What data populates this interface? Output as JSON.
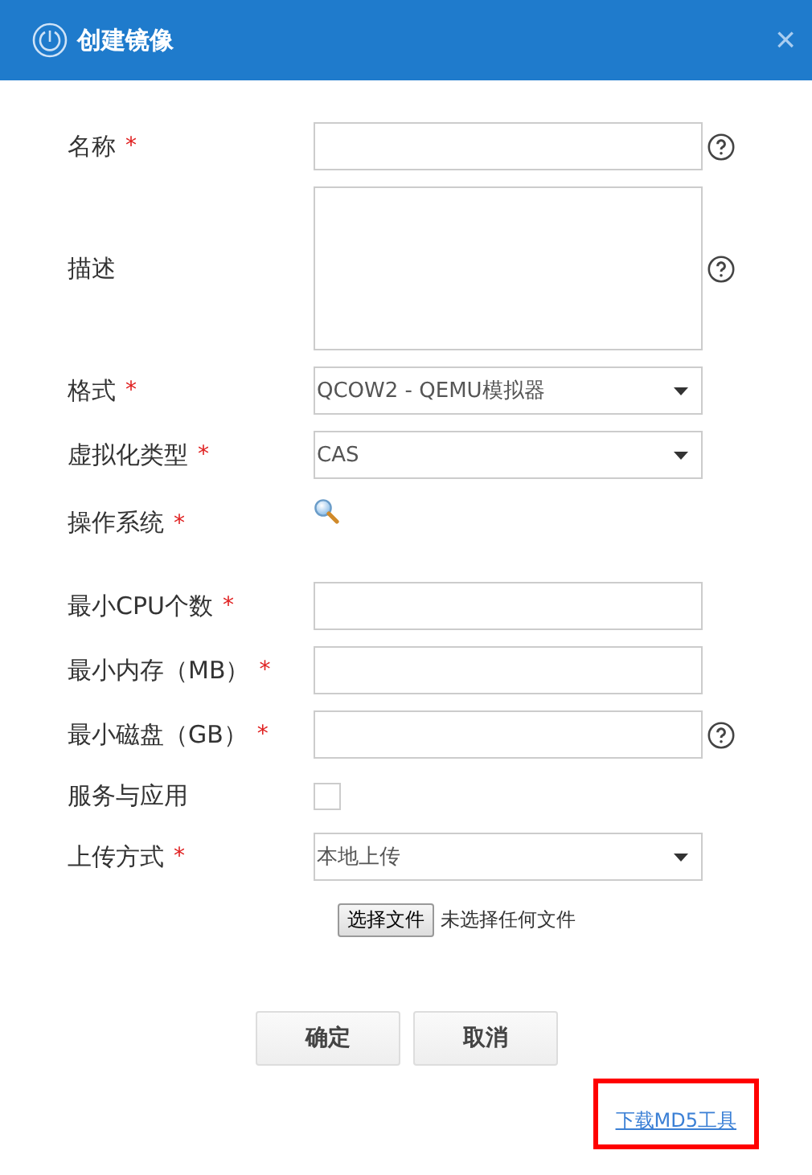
{
  "window": {
    "title": "创建镜像",
    "close": "×"
  },
  "fields": [
    {
      "kind": "text",
      "label": "名称",
      "required_mark": "*",
      "help": true
    },
    {
      "kind": "textarea",
      "label": "描述",
      "help": true
    },
    {
      "kind": "select",
      "label": "格式",
      "required_mark": "*",
      "help": false,
      "value": "QCOW2 - QEMU模拟器"
    },
    {
      "kind": "select",
      "label": "虚拟化类型",
      "required_mark": "*",
      "help": false,
      "value": "CAS"
    },
    {
      "kind": "search",
      "label": "操作系统",
      "required_mark": "*",
      "help": false
    },
    {
      "kind": "text",
      "label": "最小CPU个数",
      "required_mark": "*",
      "help": false
    },
    {
      "kind": "text",
      "label": "最小内存（MB）",
      "required_mark": "*",
      "help": false
    },
    {
      "kind": "text",
      "label": "最小磁盘（GB）",
      "required_mark": "*",
      "help": true
    },
    {
      "kind": "checkbox",
      "label": "服务与应用",
      "help": false,
      "checked": false
    },
    {
      "kind": "select",
      "label": "上传方式",
      "required_mark": "*",
      "help": false,
      "value": "本地上传"
    }
  ],
  "file_picker": {
    "button": "选择文件",
    "status": "未选择任何文件"
  },
  "buttons": [
    "确定",
    "取消"
  ],
  "download_link": {
    "text": "下载MD5工具",
    "highlighted": true
  }
}
